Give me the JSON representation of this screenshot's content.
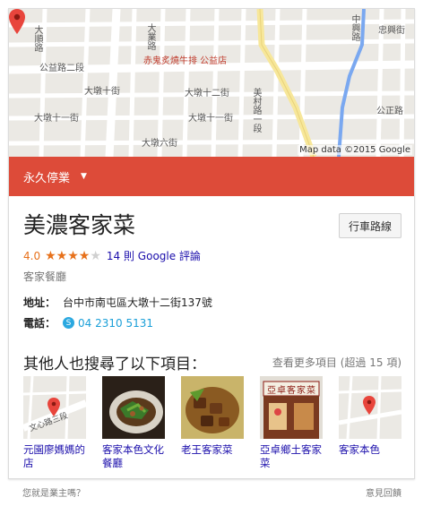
{
  "map": {
    "attribution": "Map data ©2015 Google",
    "labels": {
      "gongyi": "公益路二段",
      "chigui": "赤鬼炙燒牛排 公益店",
      "dadun12": "大墩十二街",
      "dadun11": "大墩十一街",
      "dadun10": "大墩十街",
      "dadun6": "大墩六街",
      "meicun": "美村路一段",
      "zhongxing": "忠興街",
      "gongzheng": "公正路",
      "dadun11b": "大墩十一街",
      "dashunv": "大順路",
      "dayuev": "大業路",
      "zhongxingroad": "中興路"
    }
  },
  "status": {
    "label": "永久停業",
    "caret": "▼"
  },
  "place": {
    "name": "美濃客家菜",
    "directions": "行車路線",
    "rating": "4.0",
    "stars": 4,
    "reviews": "14 則 Google 評論",
    "category": "客家餐廳",
    "address_key": "地址：",
    "address": "台中市南屯區大墩十二街137號",
    "phone_key": "電話：",
    "phone": "04 2310 5131"
  },
  "also": {
    "title": "其他人也搜尋了以下項目：",
    "more": "查看更多項目 (超過 15 項)",
    "items": [
      {
        "label": "元園廖媽媽的店",
        "thumb_road": "文心路三段"
      },
      {
        "label": "客家本色文化餐廳"
      },
      {
        "label": "老王客家菜"
      },
      {
        "label": "亞卓鄉土客家菜",
        "sign": "亞卓客家菜"
      },
      {
        "label": "客家本色"
      }
    ]
  },
  "footer": {
    "owner": "您就是業主嗎？",
    "feedback": "意見回饋"
  },
  "colors": {
    "status_bg": "#dd4b39",
    "star": "#e7711b",
    "link": "#1a0dab",
    "pin": "#e8453c"
  }
}
